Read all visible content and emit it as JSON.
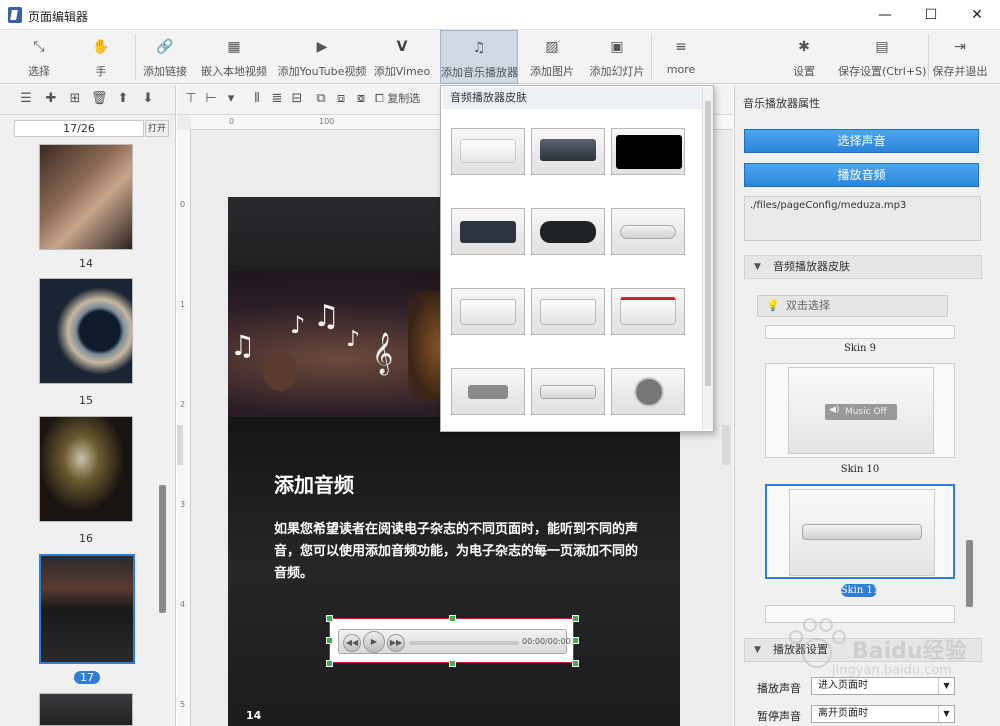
{
  "window": {
    "title": "页面编辑器",
    "minimize": "—",
    "maximize": "☐",
    "close": "✕"
  },
  "toolbar": {
    "items": [
      {
        "label": "选择",
        "icon": "select-cursor-icon",
        "glyph": "⤡"
      },
      {
        "label": "手",
        "icon": "hand-icon",
        "glyph": "✋"
      },
      {
        "label": "添加链接",
        "icon": "link-icon",
        "glyph": "🔗"
      },
      {
        "label": "嵌入本地视频",
        "icon": "film-icon",
        "glyph": "▦"
      },
      {
        "label": "添加YouTube视频",
        "icon": "youtube-icon",
        "glyph": "▶"
      },
      {
        "label": "添加Vimeo",
        "icon": "vimeo-icon",
        "glyph": "V"
      },
      {
        "label": "添加音乐播放器",
        "icon": "music-note-icon",
        "glyph": "♫"
      },
      {
        "label": "添加图片",
        "icon": "image-icon",
        "glyph": "▨"
      },
      {
        "label": "添加幻灯片",
        "icon": "slideshow-icon",
        "glyph": "▣"
      },
      {
        "label": "more",
        "icon": "more-icon",
        "glyph": "≡"
      },
      {
        "label": "设置",
        "icon": "gear-icon",
        "glyph": "✱"
      },
      {
        "label": "保存设置(Ctrl+S)",
        "icon": "save-icon",
        "glyph": "▤"
      },
      {
        "label": "保存并退出",
        "icon": "save-exit-icon",
        "glyph": "⇥"
      }
    ],
    "active_label": "添加音乐播放器"
  },
  "left_panel": {
    "page_indicator": "17/26",
    "open_button": "打开",
    "thumbnails": [
      {
        "label": "14"
      },
      {
        "label": "15"
      },
      {
        "label": "16"
      },
      {
        "label": "17",
        "selected": true
      }
    ]
  },
  "center": {
    "copy_label": "复制选",
    "ruler_top": [
      "0",
      "100"
    ],
    "ruler_left": [
      "0",
      "1",
      "2",
      "3",
      "4",
      "5"
    ],
    "page": {
      "title": "添加音频",
      "body": "如果您希望读者在阅读电子杂志的不同页面时，能听到不同的声音，您可以使用添加音频功能，为电子杂志的每一页添加不同的音频。",
      "page_number": "14",
      "player_time": "00:00/00:00"
    }
  },
  "skin_dropdown": {
    "title": "音频播放器皮肤"
  },
  "right_panel": {
    "title": "音乐播放器属性",
    "select_sound": "选择声音",
    "play_audio": "播放音频",
    "file_path": "./files/pageConfig/meduza.mp3",
    "skin_section": "音频播放器皮肤",
    "double_click_hint": "双击选择",
    "skins": [
      {
        "name": "Skin 9"
      },
      {
        "name": "Skin 10",
        "preview": "Music Off"
      },
      {
        "name": "Skin 11",
        "selected": true
      }
    ],
    "player_settings": "播放器设置",
    "play_sound_label": "播放声音",
    "play_sound_value": "进入页面时",
    "pause_sound_label": "暂停声音",
    "pause_sound_value": "离开页面时"
  },
  "watermark": {
    "brand": "Baidu经验",
    "url": "jingyan.baidu.com"
  },
  "colors": {
    "accent_blue": "#2e7dd6",
    "selection_red": "#c1272d",
    "handle_green": "#3db24a"
  }
}
